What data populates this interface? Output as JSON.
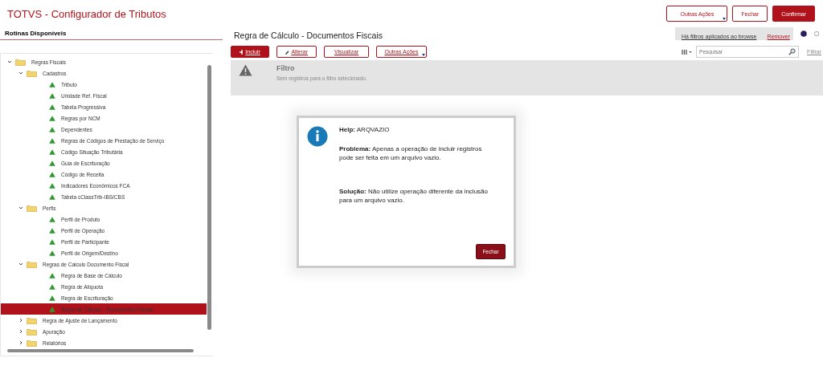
{
  "app_title": "TOTVS - Configurador de Tributos",
  "header_buttons": [
    {
      "label": "Outras Ações",
      "kind": "menu"
    },
    {
      "label": "Fechar",
      "kind": "outline"
    },
    {
      "label": "Confirmar",
      "kind": "primary"
    }
  ],
  "sidebar": {
    "title": "Rotinas Disponíveis",
    "tree": [
      {
        "label": "Regras Fiscais",
        "kind": "folder",
        "expanded": true,
        "selected": false,
        "children": [
          {
            "label": "Cadastros",
            "kind": "folder",
            "expanded": true,
            "selected": false,
            "children": [
              {
                "label": "Tributo",
                "kind": "routine",
                "selected": false
              },
              {
                "label": "Unidade Ref. Fiscal",
                "kind": "routine",
                "selected": false
              },
              {
                "label": "Tabela Progressiva",
                "kind": "routine",
                "selected": false
              },
              {
                "label": "Regras por NCM",
                "kind": "routine",
                "selected": false
              },
              {
                "label": "Dependentes",
                "kind": "routine",
                "selected": false
              },
              {
                "label": "Regras de Códigos de Prestação de Serviço",
                "kind": "routine",
                "selected": false
              },
              {
                "label": "Código Situação Tributária",
                "kind": "routine",
                "selected": false
              },
              {
                "label": "Guia de Escrituração",
                "kind": "routine",
                "selected": false
              },
              {
                "label": "Código de Receita",
                "kind": "routine",
                "selected": false
              },
              {
                "label": "Indicadores Econômicos FCA",
                "kind": "routine",
                "selected": false
              },
              {
                "label": "Tabela cClassTrib-IBS/CBS",
                "kind": "routine",
                "selected": false
              }
            ]
          },
          {
            "label": "Perfis",
            "kind": "folder",
            "expanded": true,
            "selected": false,
            "children": [
              {
                "label": "Perfil de Produto",
                "kind": "routine",
                "selected": false
              },
              {
                "label": "Perfil de Operação",
                "kind": "routine",
                "selected": false
              },
              {
                "label": "Perfil de Participante",
                "kind": "routine",
                "selected": false
              },
              {
                "label": "Perfil de Origem/Destino",
                "kind": "routine",
                "selected": false
              }
            ]
          },
          {
            "label": "Regras de Calculo Documento Fiscal",
            "kind": "folder",
            "expanded": true,
            "selected": false,
            "children": [
              {
                "label": "Regra de Base de Cálculo",
                "kind": "routine",
                "selected": false
              },
              {
                "label": "Regra de Alíquota",
                "kind": "routine",
                "selected": false
              },
              {
                "label": "Regra de Escrituração",
                "kind": "routine",
                "selected": false
              },
              {
                "label": "Regra de Cálculo - Documentos Fiscais",
                "kind": "routine",
                "selected": true
              }
            ]
          },
          {
            "label": "Regra de Ajuste de Lançamento",
            "kind": "folder",
            "expanded": false,
            "selected": false
          },
          {
            "label": "Apuração",
            "kind": "folder",
            "expanded": false,
            "selected": false
          },
          {
            "label": "Relatórios",
            "kind": "folder",
            "expanded": false,
            "selected": false
          }
        ]
      }
    ]
  },
  "main": {
    "title": "Regra de Cálculo - Documentos Fiscais",
    "filters_notice": {
      "text": "Há filtros aplicados ao browse",
      "action": "Remover"
    },
    "toolbar": [
      {
        "label": "Incluir",
        "kind": "primary"
      },
      {
        "label": "Alterar",
        "kind": "edit"
      },
      {
        "label": "Visualizar",
        "kind": "outline"
      },
      {
        "label": "Outras Ações",
        "kind": "menu"
      }
    ],
    "search": {
      "placeholder": "Pesquisar"
    },
    "filter_link": "Filtrar",
    "filter_banner": {
      "title": "Filtro",
      "message": "Sem registros para o filtro selecionado."
    }
  },
  "dialog": {
    "heading": "**Help:** ARQVAZIO",
    "problem": "**Problema:** Apenas a operação de incluir registros pode ser feita em um arquivo vazio.",
    "solution": "**Solução:** Não utilize operação diferente da inclusão para um arquivo vazio.",
    "button": "Fechar"
  }
}
